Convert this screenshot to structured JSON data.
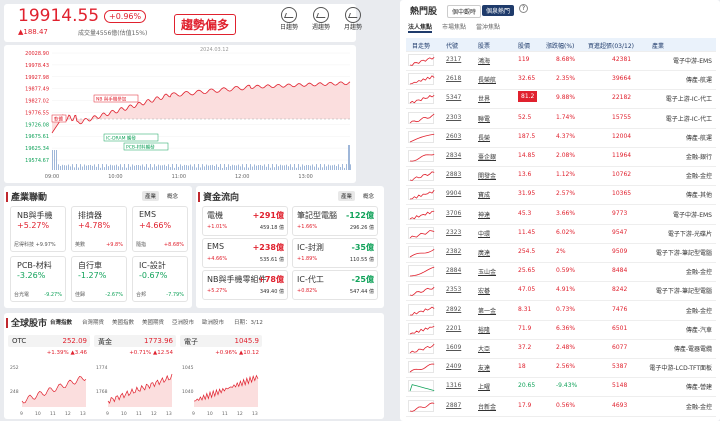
{
  "index": {
    "value": "19914.55",
    "change_pct": "+0.96%",
    "change_pts": "▲188.47",
    "volume": "成交量4556億(估值15%)",
    "trend": "趨勢偏多",
    "date": "2024.03.12",
    "indicators": [
      "日趨勢",
      "週趨勢",
      "月趨勢"
    ]
  },
  "chart_data": {
    "type": "line",
    "y_ticks": [
      "20028.90",
      "19978.43",
      "19927.98",
      "19877.49",
      "19827.02",
      "19776.55",
      "19726.08",
      "19675.61",
      "19625.34",
      "19574.67"
    ],
    "x_ticks": [
      "09:00",
      "10:00",
      "11:00",
      "12:00",
      "13:00"
    ],
    "annotations": [
      "NB 與手機參加",
      "軟體",
      "IC-DRAM 觸發",
      "PCB-材料觸發"
    ]
  },
  "sector": {
    "title": "產業聯動",
    "pills": [
      "產業",
      "概念"
    ],
    "tiles": [
      {
        "name": "NB與手機",
        "pct": "+5.27%",
        "bl": "尼得科技 +9.97%",
        "br": ""
      },
      {
        "name": "排擠器",
        "pct": "+4.78%",
        "bl": "英數",
        "br": "+9.8%"
      },
      {
        "name": "EMS",
        "pct": "+4.66%",
        "bl": "隨指",
        "br": "+8.68%"
      },
      {
        "name": "PCB-材料",
        "pct": "-3.26%",
        "bl": "台光電",
        "br": "-9.27%"
      },
      {
        "name": "自行車",
        "pct": "-1.27%",
        "bl": "佳歸",
        "br": "-2.67%"
      },
      {
        "name": "IC-設計",
        "pct": "-0.67%",
        "bl": "合邦",
        "br": "-7.79%"
      }
    ]
  },
  "flow": {
    "title": "資金流向",
    "pills": [
      "產業",
      "概念"
    ],
    "items": [
      {
        "name": "電機",
        "val": "+291億",
        "sub1": "+1.01%",
        "sub2": "459.18 億",
        "up": true
      },
      {
        "name": "筆記型電腦",
        "val": "-122億",
        "sub1": "+1.66%",
        "sub2": "296.26 億",
        "up": false
      },
      {
        "name": "EMS",
        "val": "+238億",
        "sub1": "+4.66%",
        "sub2": "535.61 億",
        "up": true
      },
      {
        "name": "IC-封測",
        "val": "-35億",
        "sub1": "+1.89%",
        "sub2": "110.55 億",
        "up": false
      },
      {
        "name": "NB與手機零組件",
        "val": "+78億",
        "sub1": "+5.27%",
        "sub2": "349.40 億",
        "up": true
      },
      {
        "name": "IC-代工",
        "val": "-25億",
        "sub1": "+0.82%",
        "sub2": "547.44 億",
        "up": false
      }
    ]
  },
  "global": {
    "title": "全球股市",
    "tabs": [
      "台灣指數",
      "台灣期貨",
      "美國指數",
      "美國期貨",
      "亞洲股市",
      "歐洲股市"
    ],
    "date": "日期：3/12",
    "cards": [
      {
        "name": "OTC",
        "price": "252.09",
        "sub": "+1.39% ▲3.46",
        "y": [
          "252",
          "248"
        ],
        "x": [
          "9",
          "10",
          "11",
          "12",
          "13"
        ]
      },
      {
        "name": "黃金",
        "price": "1773.96",
        "sub": "+0.71% ▲12.54",
        "y": [
          "1774",
          "1768"
        ],
        "x": [
          "9",
          "10",
          "11",
          "12",
          "13"
        ]
      },
      {
        "name": "電子",
        "price": "1045.9",
        "sub": "+0.96% ▲10.12",
        "y": [
          "1045",
          "1040"
        ],
        "x": [
          "9",
          "10",
          "11",
          "12",
          "13"
        ]
      }
    ]
  },
  "hot": {
    "title": "熱門股",
    "tabs": [
      "個中觀時",
      "個泉熱門"
    ],
    "subtabs": [
      "法人焦點",
      "市場焦點",
      "當沖焦點"
    ],
    "headers": [
      "目走勢",
      "代號",
      "股票",
      "股價",
      "漲跌幅(%)",
      "買進超張(03/12)",
      "產業"
    ],
    "rows": [
      [
        "2317",
        "鴻海",
        "119",
        "8.68%",
        "42381",
        "電子中游-EMS"
      ],
      [
        "2618",
        "長榮航",
        "32.65",
        "2.35%",
        "39664",
        "傳產-航運"
      ],
      [
        "5347",
        "世界",
        "81.2",
        "9.88%",
        "22182",
        "電子上游-IC-代工"
      ],
      [
        "2303",
        "聯電",
        "52.5",
        "1.74%",
        "15755",
        "電子上游-IC-代工"
      ],
      [
        "2603",
        "長榮",
        "187.5",
        "4.37%",
        "12004",
        "傳產-航運"
      ],
      [
        "2834",
        "臺企銀",
        "14.85",
        "2.08%",
        "11964",
        "金融-銀行"
      ],
      [
        "2883",
        "開發金",
        "13.6",
        "1.12%",
        "10762",
        "金融-金控"
      ],
      [
        "9904",
        "寶成",
        "31.95",
        "2.57%",
        "10365",
        "傳產-其他"
      ],
      [
        "3706",
        "神達",
        "45.3",
        "3.66%",
        "9773",
        "電子中游-EMS"
      ],
      [
        "2323",
        "中環",
        "11.45",
        "6.02%",
        "9547",
        "電子下游-光碟片"
      ],
      [
        "2382",
        "廣達",
        "254.5",
        "2%",
        "9509",
        "電子下游-筆記型電腦"
      ],
      [
        "2884",
        "玉山金",
        "25.65",
        "0.59%",
        "8484",
        "金融-金控"
      ],
      [
        "2353",
        "宏碁",
        "47.05",
        "4.91%",
        "8242",
        "電子下游-筆記型電腦"
      ],
      [
        "2892",
        "第一金",
        "8.31",
        "0.73%",
        "7476",
        "金融-金控"
      ],
      [
        "2201",
        "裕隆",
        "71.9",
        "6.36%",
        "6501",
        "傳產-汽車"
      ],
      [
        "1609",
        "大亞",
        "37.2",
        "2.48%",
        "6077",
        "傳產-電器電纜"
      ],
      [
        "2409",
        "友達",
        "18",
        "2.56%",
        "5387",
        "電子中游-LCD-TFT面板"
      ],
      [
        "1316",
        "上曜",
        "20.65",
        "-9.43%",
        "5148",
        "傳產-營建"
      ],
      [
        "2887",
        "台新金",
        "17.9",
        "0.56%",
        "4693",
        "金融-金控"
      ]
    ]
  }
}
